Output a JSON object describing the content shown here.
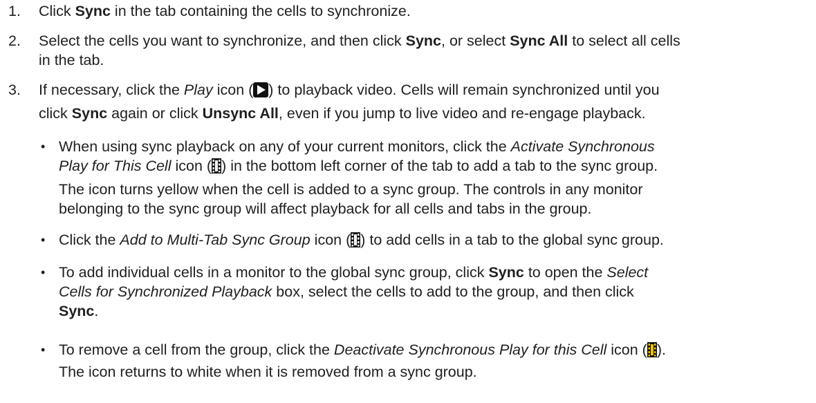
{
  "steps": [
    {
      "num": "1.",
      "t1": "Click ",
      "b1": "Sync",
      "t2": " in the tab containing the cells to synchronize."
    },
    {
      "num": "2.",
      "t1": "Select the cells you want to synchronize, and then click ",
      "b1": "Sync",
      "t2": ", or select ",
      "b2": "Sync All",
      "t3": " to select all cells",
      "l2": "in the tab."
    },
    {
      "num": "3.",
      "t1": "If necessary, click the ",
      "i1": "Play",
      "t2": " icon (",
      "t3": ") to playback video. Cells will remain synchronized until you",
      "l2a": "click ",
      "l2b": "Sync",
      "l2c": " again or click ",
      "l2d": "Unsync All",
      "l2e": ", even if you jump to live video and re-engage playback."
    }
  ],
  "bullets": [
    {
      "a1": "When using sync playback on any of your current monitors, click the ",
      "a2": "Activate Synchronous",
      "b1": "Play for This Cell",
      "b2": " icon (",
      "b3": ") in the bottom left corner of the tab to add a tab to the sync group.",
      "c1": "The icon turns yellow when the cell is added to a sync group. The controls in any monitor",
      "d1": "belonging to the sync group will affect playback for all cells and tabs in the group."
    },
    {
      "a1": "Click the ",
      "a2": "Add to Multi-Tab Sync Group",
      "a3": " icon (",
      "a4": ") to add cells in a tab to the global sync group."
    },
    {
      "a1": "To add individual cells in a monitor to the global sync group, click ",
      "a2": "Sync",
      "a3": " to open the ",
      "a4": "Select",
      "b1": "Cells for Synchronized Playback",
      "b2": " box, select the cells to add to the group, and then click",
      "c1": "Sync",
      "c2": "."
    },
    {
      "a1": "To remove a cell from the group, click the ",
      "a2": "Deactivate Synchronous Play for this Cell",
      "a3": " icon (",
      "a4": ").",
      "b1": "The icon returns to white when it is removed from a sync group."
    }
  ],
  "bullet_char": "•",
  "colors": {
    "text": "#1f1f1f",
    "icon_dark": "#111111",
    "icon_white": "#ffffff",
    "icon_yellow": "#f2c200"
  },
  "icons": [
    "play-icon",
    "film-strip-icon",
    "film-strip-icon",
    "film-strip-yellow-icon"
  ]
}
